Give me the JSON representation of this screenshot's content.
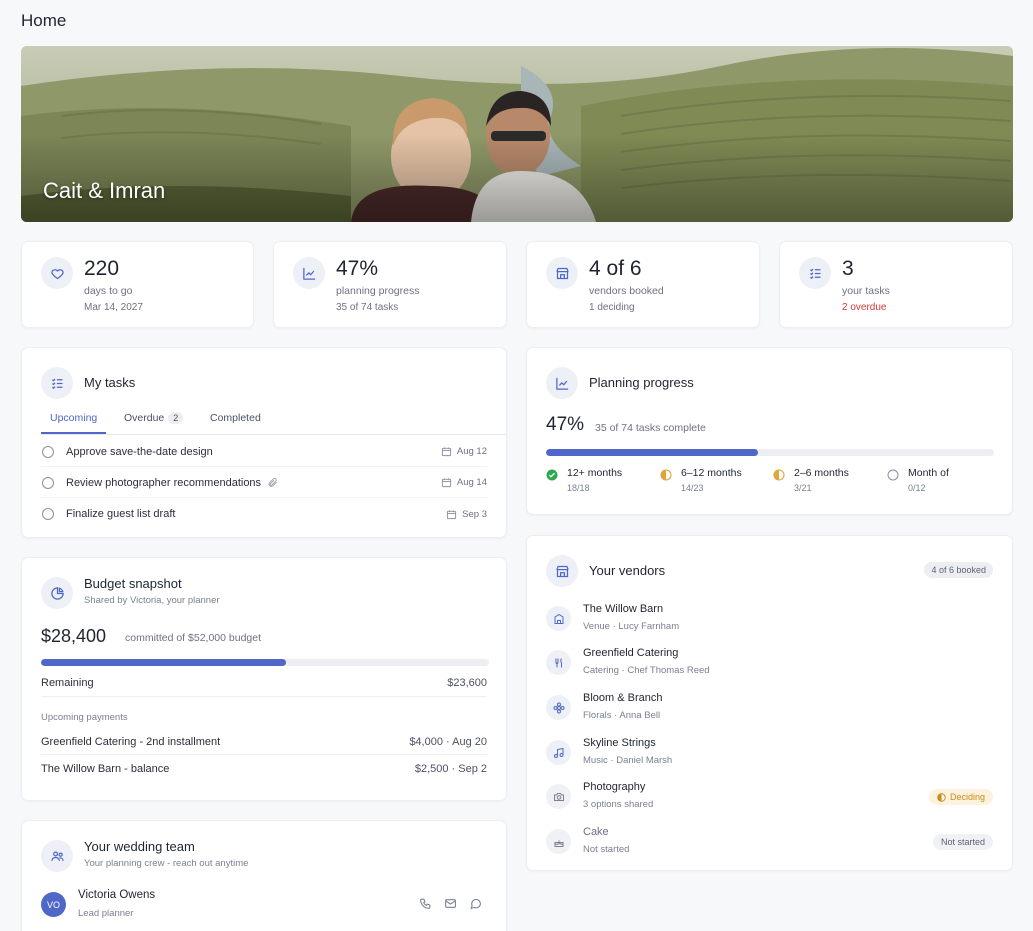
{
  "page": {
    "title": "Home"
  },
  "hero": {
    "couple": "Cait & Imran"
  },
  "stats": [
    {
      "value": "220",
      "label": "days to go",
      "detail": "Mar 14, 2027",
      "icon": "heart-icon"
    },
    {
      "value": "47%",
      "label": "planning progress",
      "detail": "35 of 74 tasks",
      "icon": "trend-icon"
    },
    {
      "value": "4 of 6",
      "label": "vendors booked",
      "detail": "1 deciding",
      "icon": "store-icon"
    },
    {
      "value": "3",
      "label": "your tasks",
      "detail": "2 overdue",
      "icon": "checklist-icon"
    }
  ],
  "tasks": {
    "title": "My tasks",
    "tabs": [
      {
        "label": "Upcoming",
        "active": true
      },
      {
        "label": "Overdue",
        "count": "2"
      },
      {
        "label": "Completed"
      }
    ],
    "items": [
      {
        "label": "Approve save-the-date design",
        "date": "Aug 12"
      },
      {
        "label": "Review photographer recommendations",
        "date": "Aug 14",
        "attachment": true
      },
      {
        "label": "Finalize guest list draft",
        "date": "Sep 3"
      }
    ]
  },
  "budget": {
    "title": "Budget snapshot",
    "subtitle": "Shared by Victoria, your planner",
    "committed": "$28,400",
    "committed_label": "committed of $52,000 budget",
    "progress": 0.546,
    "remaining_label": "Remaining",
    "remaining_value": "$23,600",
    "upcoming_label": "Upcoming payments",
    "payments": [
      {
        "label": "Greenfield Catering - 2nd installment",
        "value": "$4,000 · Aug 20"
      },
      {
        "label": "The Willow Barn - balance",
        "value": "$2,500 · Sep 2"
      }
    ]
  },
  "team": {
    "title": "Your wedding team",
    "subtitle": "Your planning crew - reach out anytime",
    "member": {
      "initials": "VO",
      "name": "Victoria Owens",
      "role": "Lead planner"
    }
  },
  "progress": {
    "title": "Planning progress",
    "percent": "47%",
    "summary": "35 of 74 tasks complete",
    "fraction": 0.473,
    "phases": [
      {
        "label": "12+ months",
        "value": "18/18",
        "status": "complete"
      },
      {
        "label": "6–12 months",
        "value": "14/23",
        "status": "partial"
      },
      {
        "label": "2–6 months",
        "value": "3/21",
        "status": "partial"
      },
      {
        "label": "Month of",
        "value": "0/12",
        "status": "empty"
      }
    ]
  },
  "vendors": {
    "title": "Your vendors",
    "badge": "4 of 6 booked",
    "items": [
      {
        "name": "The Willow Barn",
        "detail": "Venue · Lucy Farnham",
        "icon": "building-icon"
      },
      {
        "name": "Greenfield Catering",
        "detail": "Catering · Chef Thomas Reed",
        "icon": "utensils-icon"
      },
      {
        "name": "Bloom & Branch",
        "detail": "Florals · Anna Bell",
        "icon": "flower-icon"
      },
      {
        "name": "Skyline Strings",
        "detail": "Music · Daniel Marsh",
        "icon": "music-icon"
      },
      {
        "name": "Photography",
        "detail": "3 options shared",
        "icon": "camera-icon",
        "status": "Deciding"
      },
      {
        "name": "Cake",
        "detail": "Not started",
        "icon": "cake-icon",
        "status": "Not started"
      }
    ]
  },
  "colors": {
    "accent": "#4f67c8",
    "danger": "#d23a3a",
    "warning": "#c88a1c",
    "success": "#2fa84f"
  }
}
